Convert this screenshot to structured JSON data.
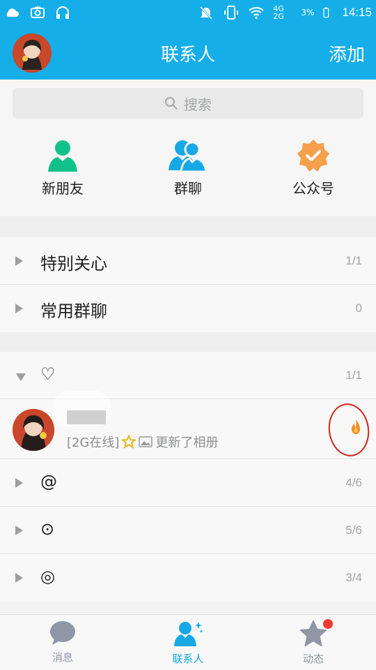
{
  "status_bar": {
    "network": "4G 2G",
    "battery": "3%",
    "time": "14:15"
  },
  "header": {
    "title": "联系人",
    "add_label": "添加"
  },
  "search": {
    "placeholder": "搜索"
  },
  "quick_actions": [
    {
      "label": "新朋友",
      "icon": "new-friend-icon",
      "color": "#12c18a"
    },
    {
      "label": "群聊",
      "icon": "group-chat-icon",
      "color": "#18a8e6"
    },
    {
      "label": "公众号",
      "icon": "official-account-icon",
      "color": "#f5a04a"
    }
  ],
  "top_groups": [
    {
      "label": "特别关心",
      "count": "1/1"
    },
    {
      "label": "常用群聊",
      "count": "0"
    }
  ],
  "friend_groups": [
    {
      "label": "♡",
      "count": "1/1",
      "expanded": true
    },
    {
      "label": "@",
      "count": "4/6",
      "expanded": false
    },
    {
      "label": "⊙",
      "count": "5/6",
      "expanded": false
    },
    {
      "label": "◎",
      "count": "3/4",
      "expanded": false
    }
  ],
  "contact": {
    "status": "[2G在线]",
    "update_text": "更新了相册"
  },
  "tabs": [
    {
      "label": "消息",
      "icon": "message-icon",
      "active": false
    },
    {
      "label": "联系人",
      "icon": "contacts-icon",
      "active": true
    },
    {
      "label": "动态",
      "icon": "star-icon",
      "active": false
    }
  ],
  "colors": {
    "brand": "#15aee9",
    "tab_active": "#18a8e6",
    "tab_inactive": "#8f97a6",
    "badge": "#f23a2d"
  }
}
